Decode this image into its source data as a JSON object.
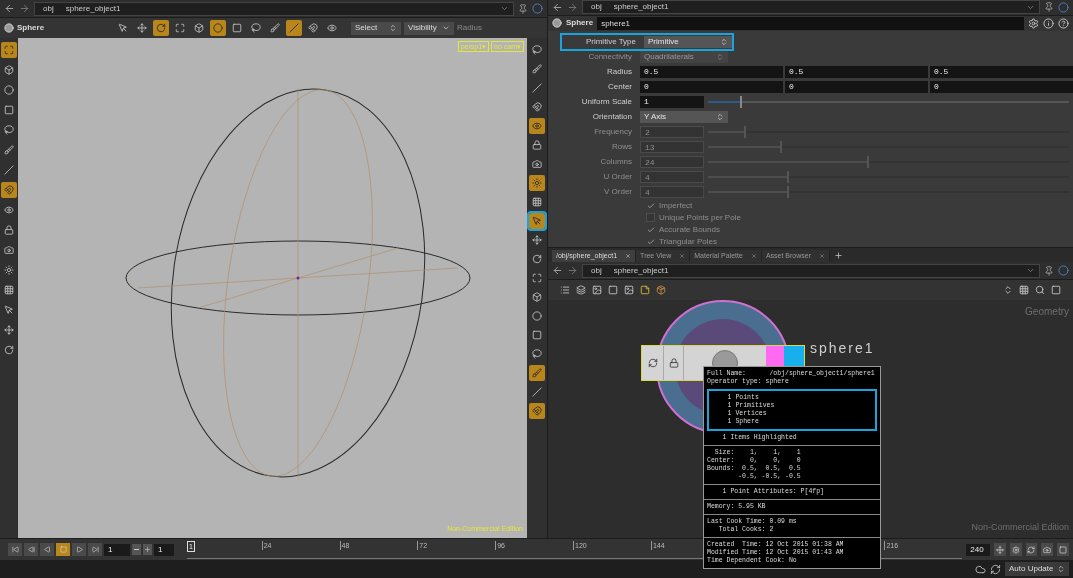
{
  "viewer": {
    "path": [
      "obj",
      "sphere_object1"
    ],
    "tool_name": "Sphere",
    "tools": [
      {
        "selected": false
      },
      {
        "selected": false
      },
      {
        "selected": true
      },
      {
        "selected": false
      },
      {
        "selected": false
      },
      {
        "selected": true
      },
      {
        "selected": false
      },
      {
        "selected": false
      },
      {
        "selected": false
      },
      {
        "selected": true
      },
      {
        "selected": false
      },
      {
        "selected": false
      }
    ],
    "select_menu": "Select",
    "visibility_menu": "Visibility",
    "radius_label": "Radius",
    "camera_badges": [
      "persp1▾",
      "no cam▾"
    ],
    "edition": "Non-Commercial Edition",
    "left_tools": [
      {
        "selected": true
      },
      {
        "selected": false
      },
      {
        "selected": false
      },
      {
        "selected": false
      },
      {
        "selected": false
      },
      {
        "selected": false
      },
      {
        "selected": false
      },
      {
        "selected": true
      },
      {
        "selected": false
      },
      {
        "selected": false
      },
      {
        "selected": false
      },
      {
        "selected": false
      },
      {
        "selected": false
      },
      {
        "selected": false
      },
      {
        "selected": false
      },
      {
        "selected": false
      }
    ],
    "right_tools": [
      {
        "selected": false,
        "highlighted": false
      },
      {
        "selected": false,
        "highlighted": false
      },
      {
        "selected": false,
        "highlighted": false
      },
      {
        "selected": false,
        "highlighted": false
      },
      {
        "selected": true,
        "highlighted": false
      },
      {
        "selected": false,
        "highlighted": false
      },
      {
        "selected": false,
        "highlighted": false
      },
      {
        "selected": true,
        "highlighted": false
      },
      {
        "selected": false,
        "highlighted": false
      },
      {
        "selected": true,
        "highlighted": true
      },
      {
        "selected": false,
        "highlighted": false
      },
      {
        "selected": false,
        "highlighted": false
      },
      {
        "selected": false,
        "highlighted": false
      },
      {
        "selected": false,
        "highlighted": false
      },
      {
        "selected": false,
        "highlighted": false
      },
      {
        "selected": false,
        "highlighted": false
      },
      {
        "selected": false,
        "highlighted": false
      },
      {
        "selected": true,
        "highlighted": false
      },
      {
        "selected": false,
        "highlighted": false
      },
      {
        "selected": true,
        "highlighted": false
      }
    ]
  },
  "parameters": {
    "path": [
      "obj",
      "sphere_object1"
    ],
    "node_type": "Sphere",
    "node_name": "sphere1",
    "rows": [
      {
        "kind": "menu",
        "label": "Primitive Type",
        "value": "Primitive",
        "disabled": false,
        "highlighted": true
      },
      {
        "kind": "menu",
        "label": "Connectivity",
        "value": "Quadrilaterals",
        "disabled": true,
        "highlighted": false
      },
      {
        "kind": "vector",
        "label": "Radius",
        "values": [
          "0.5",
          "0.5",
          "0.5"
        ]
      },
      {
        "kind": "vector",
        "label": "Center",
        "values": [
          "0",
          "0",
          "0"
        ]
      },
      {
        "kind": "slider",
        "label": "Uniform Scale",
        "value": "1",
        "level": 0.09,
        "disabled": false
      },
      {
        "kind": "menu",
        "label": "Orientation",
        "value": "Y Axis",
        "disabled": false,
        "highlighted": false
      },
      {
        "kind": "slider",
        "label": "Frequency",
        "value": "2",
        "level": 0.1,
        "disabled": true
      },
      {
        "kind": "slider",
        "label": "Rows",
        "value": "13",
        "level": 0.2,
        "disabled": true
      },
      {
        "kind": "slider",
        "label": "Columns",
        "value": "24",
        "level": 0.44,
        "disabled": true
      },
      {
        "kind": "slider",
        "label": "U Order",
        "value": "4",
        "level": 0.22,
        "disabled": true
      },
      {
        "kind": "slider",
        "label": "V Order",
        "value": "4",
        "level": 0.22,
        "disabled": true
      },
      {
        "kind": "toggle",
        "label": "Imperfect",
        "checked": true
      },
      {
        "kind": "toggle",
        "label": "Unique Points per Pole",
        "checked": false
      },
      {
        "kind": "toggle",
        "label": "Accurate Bounds",
        "checked": true
      },
      {
        "kind": "toggle",
        "label": "Triangular Poles",
        "checked": true
      }
    ]
  },
  "network": {
    "tabs": [
      {
        "label": "/obj/sphere_object1",
        "selected": true
      },
      {
        "label": "Tree View",
        "selected": false
      },
      {
        "label": "Material Palette",
        "selected": false
      },
      {
        "label": "Asset Browser",
        "selected": false
      }
    ],
    "path": [
      "obj",
      "sphere_object1"
    ],
    "context_label": "Geometry",
    "node_label": "sphere1",
    "edition": "Non-Commercial Edition",
    "info_popup": [
      {
        "lines": [
          "Full Name:      /obj/sphere_object1/sphere1",
          "Operator type: sphere"
        ],
        "highlighted": false
      },
      {
        "lines": [
          "    1 Points",
          "    1 Primitives",
          "    1 Vertices",
          "    1 Sphere"
        ],
        "highlighted": true
      },
      {
        "lines": [
          "    1 Items Highlighted"
        ],
        "highlighted": false
      },
      {
        "lines": [
          "  Size:    1,    1,    1",
          "Center:    0,    0,    0",
          "Bounds:  0.5,  0.5,  0.5",
          "        -0.5, -0.5, -0.5"
        ],
        "highlighted": false
      },
      {
        "lines": [
          "    1 Point Attributes: P[4fp]"
        ],
        "highlighted": false
      },
      {
        "lines": [
          "Memory: 5.95 KB"
        ],
        "highlighted": false
      },
      {
        "lines": [
          "Last Cook Time: 0.09 ms",
          "   Total Cooks: 2"
        ],
        "highlighted": false
      },
      {
        "lines": [
          "Created  Time: 12 Oct 2015 01:38 AM",
          "Modified Time: 12 Oct 2015 01:43 AM",
          "Time Dependent Cook: No"
        ],
        "highlighted": false
      }
    ]
  },
  "timeline": {
    "frame": "1",
    "start": "1",
    "current_marker": "1",
    "ticks": [
      "24",
      "48",
      "72",
      "96",
      "120",
      "144",
      "216"
    ],
    "end": "240"
  },
  "status_bar": {
    "update_mode": "Auto Update"
  }
}
